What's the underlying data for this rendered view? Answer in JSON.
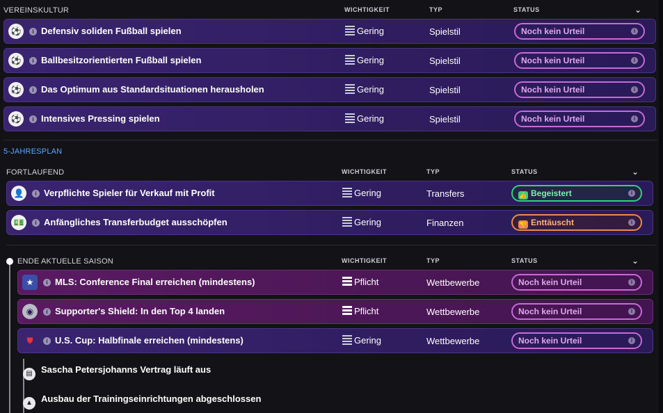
{
  "columns": {
    "importance": "WICHTIGKEIT",
    "type": "TYP",
    "status": "STATUS"
  },
  "club_culture": {
    "title": "VEREINSKULTUR",
    "rows": [
      {
        "name": "Defensiv soliden Fußball spielen",
        "importance": "Gering",
        "type": "Spielstil",
        "status": "Noch kein Urteil"
      },
      {
        "name": "Ballbesitzorientierten Fußball spielen",
        "importance": "Gering",
        "type": "Spielstil",
        "status": "Noch kein Urteil"
      },
      {
        "name": "Das Optimum aus Standardsituationen herausholen",
        "importance": "Gering",
        "type": "Spielstil",
        "status": "Noch kein Urteil"
      },
      {
        "name": "Intensives Pressing spielen",
        "importance": "Gering",
        "type": "Spielstil",
        "status": "Noch kein Urteil"
      }
    ]
  },
  "five_year_plan": {
    "title": "5-JAHRESPLAN"
  },
  "ongoing": {
    "title": "FORTLAUFEND",
    "rows": [
      {
        "name": "Verpflichte Spieler für Verkauf mit Profit",
        "importance": "Gering",
        "type": "Transfers",
        "status": "Begeistert"
      },
      {
        "name": "Anfängliches Transferbudget ausschöpfen",
        "importance": "Gering",
        "type": "Finanzen",
        "status": "Enttäuscht"
      }
    ]
  },
  "season_end": {
    "title": "ENDE AKTUELLE SAISON",
    "rows": [
      {
        "name": "MLS: Conference Final erreichen (mindestens)",
        "importance": "Pflicht",
        "type": "Wettbewerbe",
        "status": "Noch kein Urteil"
      },
      {
        "name": "Supporter's Shield: In den Top 4 landen",
        "importance": "Pflicht",
        "type": "Wettbewerbe",
        "status": "Noch kein Urteil"
      },
      {
        "name": "U.S. Cup: Halbfinale erreichen (mindestens)",
        "importance": "Gering",
        "type": "Wettbewerbe",
        "status": "Noch kein Urteil"
      }
    ],
    "events": [
      "Sascha Petersjohanns Vertrag läuft aus",
      "Ausbau der Trainingseinrichtungen abgeschlossen"
    ]
  },
  "icons": {
    "info": "i",
    "chevron": "⌄"
  },
  "colors": {
    "status_neutral": "#c86ad8",
    "status_positive": "#34d27a",
    "status_negative": "#f08a44"
  }
}
